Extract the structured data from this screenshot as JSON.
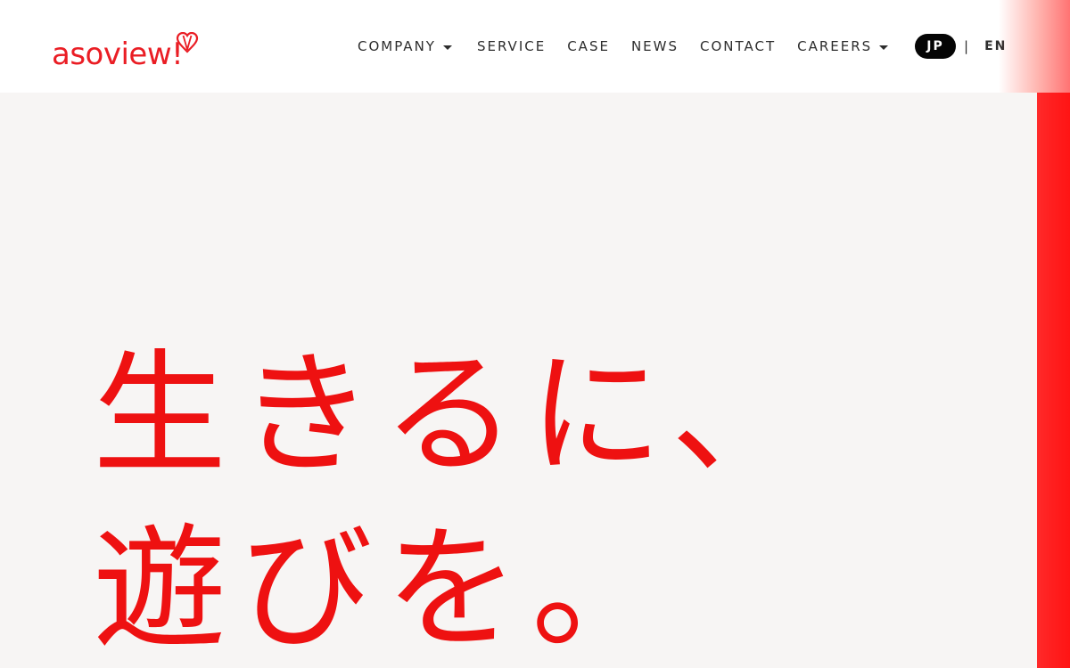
{
  "header": {
    "logo": {
      "text": "asoview!",
      "icon": "balloon-heart-icon",
      "color": "#ea1d24"
    },
    "nav": [
      {
        "label": "COMPANY",
        "has_dropdown": true
      },
      {
        "label": "SERVICE",
        "has_dropdown": false
      },
      {
        "label": "CASE",
        "has_dropdown": false
      },
      {
        "label": "NEWS",
        "has_dropdown": false
      },
      {
        "label": "CONTACT",
        "has_dropdown": false
      },
      {
        "label": "CAREERS",
        "has_dropdown": true
      }
    ],
    "language": {
      "active": "JP",
      "separator": "|",
      "other": "EN"
    }
  },
  "hero": {
    "line1": "生きるに、",
    "line2": "遊びを。",
    "color": "#ee1111"
  },
  "theme": {
    "accent": "#ff1f1f",
    "background": "#f7f5f4",
    "nav_text": "#2d2d2d"
  }
}
